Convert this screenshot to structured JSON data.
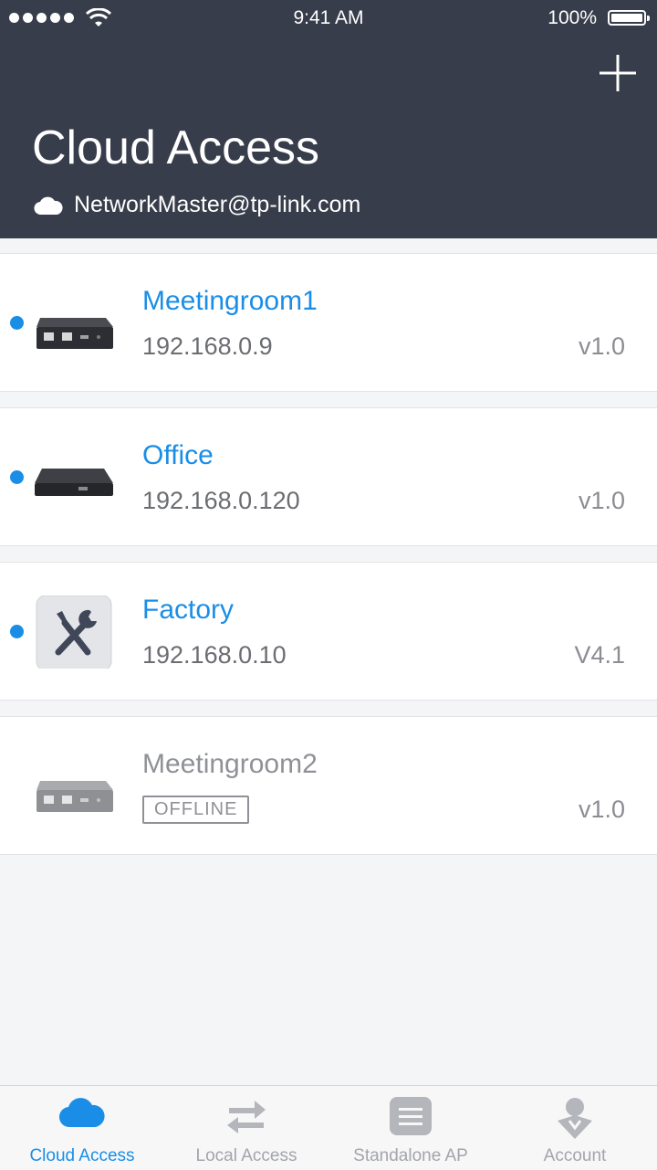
{
  "status_bar": {
    "time": "9:41 AM",
    "battery": "100%"
  },
  "header": {
    "title": "Cloud Access",
    "account_email": "NetworkMaster@tp-link.com"
  },
  "devices": [
    {
      "name": "Meetingroom1",
      "ip": "192.168.0.9",
      "version": "v1.0",
      "status": "online",
      "image": "controller-device"
    },
    {
      "name": "Office",
      "ip": "192.168.0.120",
      "version": "v1.0",
      "status": "online",
      "image": "controller-device"
    },
    {
      "name": "Factory",
      "ip": "192.168.0.10",
      "version": "V4.1",
      "status": "online",
      "image": "tools-icon"
    },
    {
      "name": "Meetingroom2",
      "status_label": "OFFLINE",
      "version": "v1.0",
      "status": "offline",
      "image": "controller-device"
    }
  ],
  "tabbar": {
    "tabs": [
      {
        "label": "Cloud Access",
        "icon": "cloud-icon",
        "active": true
      },
      {
        "label": "Local Access",
        "icon": "transfer-arrows-icon",
        "active": false
      },
      {
        "label": "Standalone AP",
        "icon": "list-icon",
        "active": false
      },
      {
        "label": "Account",
        "icon": "user-icon",
        "active": false
      }
    ]
  },
  "colors": {
    "header_bg": "#383d4b",
    "accent": "#1a8ee6",
    "background": "#f4f5f7"
  }
}
